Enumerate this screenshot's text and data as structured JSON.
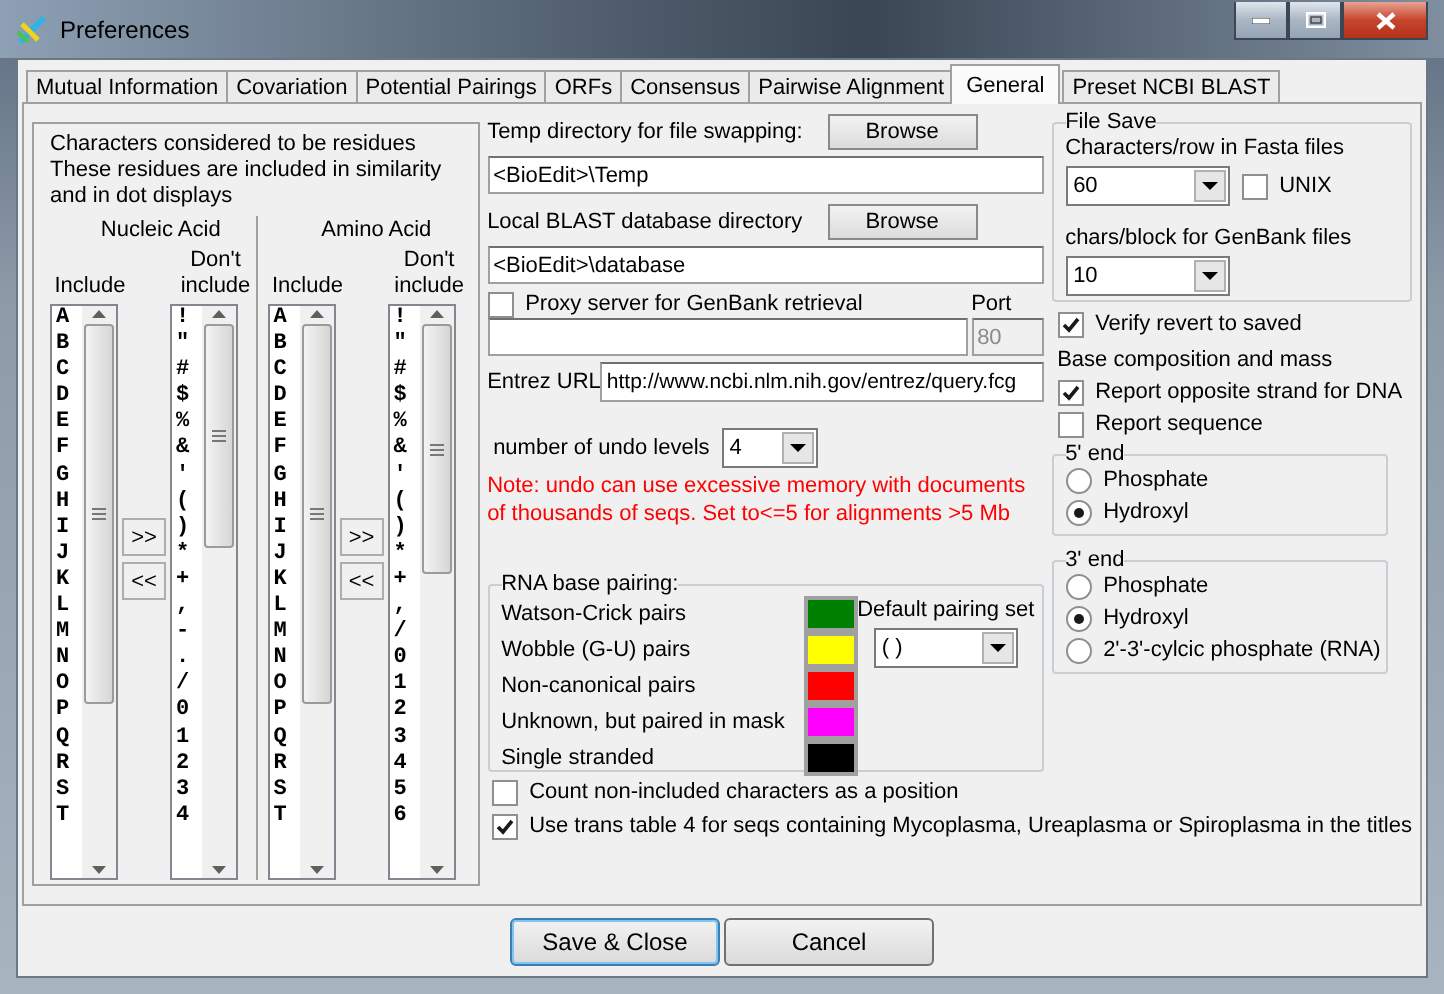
{
  "window": {
    "title": "Preferences"
  },
  "tabs": [
    {
      "label": "Mutual Information",
      "selected": false
    },
    {
      "label": "Covariation",
      "selected": false
    },
    {
      "label": "Potential Pairings",
      "selected": false
    },
    {
      "label": "ORFs",
      "selected": false
    },
    {
      "label": "Consensus",
      "selected": false
    },
    {
      "label": "Pairwise Alignment",
      "selected": false
    },
    {
      "label": "General",
      "selected": true
    },
    {
      "label": "Preset NCBI BLAST",
      "selected": false
    }
  ],
  "residues": {
    "description": [
      "Characters considered to be residues",
      "These residues are included in similarity",
      "and in dot displays"
    ],
    "groups": [
      {
        "title": "Nucleic Acid",
        "include_label": "Include",
        "exclude_label": "Don't include",
        "move_right": ">>",
        "move_left": "<<",
        "include": [
          "A",
          "B",
          "C",
          "D",
          "E",
          "F",
          "G",
          "H",
          "I",
          "J",
          "K",
          "L",
          "M",
          "N",
          "O",
          "P",
          "Q",
          "R",
          "S",
          "T"
        ],
        "exclude": [
          "!",
          "\"",
          "#",
          "$",
          "%",
          "&",
          "'",
          "(",
          ")",
          "*",
          "+",
          ",",
          "-",
          ".",
          "/",
          "0",
          "1",
          "2",
          "3",
          "4"
        ]
      },
      {
        "title": "Amino Acid",
        "include_label": "Include",
        "exclude_label": "Don't include",
        "move_right": ">>",
        "move_left": "<<",
        "include": [
          "A",
          "B",
          "C",
          "D",
          "E",
          "F",
          "G",
          "H",
          "I",
          "J",
          "K",
          "L",
          "M",
          "N",
          "O",
          "P",
          "Q",
          "R",
          "S",
          "T"
        ],
        "exclude": [
          "!",
          "\"",
          "#",
          "$",
          "%",
          "&",
          "'",
          "(",
          ")",
          "*",
          "+",
          ",",
          "/",
          "0",
          "1",
          "2",
          "3",
          "4",
          "5",
          "6"
        ]
      }
    ]
  },
  "directories": {
    "temp_label": "Temp directory for file swapping:",
    "temp_button": "Browse",
    "temp_value": "<BioEdit>\\Temp",
    "blast_label": "Local BLAST database directory",
    "blast_button": "Browse",
    "blast_value": "<BioEdit>\\database"
  },
  "proxy": {
    "label": "Proxy server for GenBank retrieval",
    "checked": false,
    "port_label": "Port",
    "port": "80"
  },
  "entrez": {
    "label": "Entrez URL",
    "value": "http://www.ncbi.nlm.nih.gov/entrez/query.fcg"
  },
  "undo": {
    "label": "number of undo levels",
    "value": "4",
    "note": "Note: undo can use excessive memory with documents of thousands of seqs. Set to<=5 for alignments >5 Mb"
  },
  "rna_pairing": {
    "title": "RNA base pairing:",
    "default_label": "Default pairing set",
    "default_value": "( )",
    "pairs": [
      {
        "label": "Watson-Crick pairs",
        "color": "#008000"
      },
      {
        "label": "Wobble (G-U) pairs",
        "color": "#ffff00"
      },
      {
        "label": "Non-canonical pairs",
        "color": "#ff0000"
      },
      {
        "label": "Unknown, but paired in mask",
        "color": "#ff00ff"
      },
      {
        "label": "Single stranded",
        "color": "#000000"
      }
    ]
  },
  "options": [
    {
      "label": "Count non-included characters as a position",
      "checked": false
    },
    {
      "label": "Use trans table 4 for seqs containing Mycoplasma, Ureaplasma or Spiroplasma in the titles",
      "checked": true
    }
  ],
  "file_save": {
    "title": "File Save",
    "fasta_label": "Characters/row in Fasta files",
    "fasta_value": "60",
    "unix_label": "UNIX",
    "unix_checked": false,
    "genbank_label": "chars/block for GenBank files",
    "genbank_value": "10"
  },
  "verify": {
    "label": "Verify revert to saved",
    "checked": true
  },
  "base_composition": {
    "title": "Base composition and mass",
    "options": [
      {
        "label": "Report opposite strand for DNA",
        "checked": true
      },
      {
        "label": "Report sequence",
        "checked": false
      }
    ]
  },
  "ends": [
    {
      "title": "5' end",
      "options": [
        {
          "label": "Phosphate",
          "selected": false
        },
        {
          "label": "Hydroxyl",
          "selected": true
        }
      ]
    },
    {
      "title": "3' end",
      "options": [
        {
          "label": "Phosphate",
          "selected": false
        },
        {
          "label": "Hydroxyl",
          "selected": true
        },
        {
          "label": "2'-3'-cylcic phosphate (RNA)",
          "selected": false
        }
      ]
    }
  ],
  "buttons": [
    {
      "label": "Save & Close",
      "default": true
    },
    {
      "label": "Cancel",
      "default": false
    }
  ]
}
